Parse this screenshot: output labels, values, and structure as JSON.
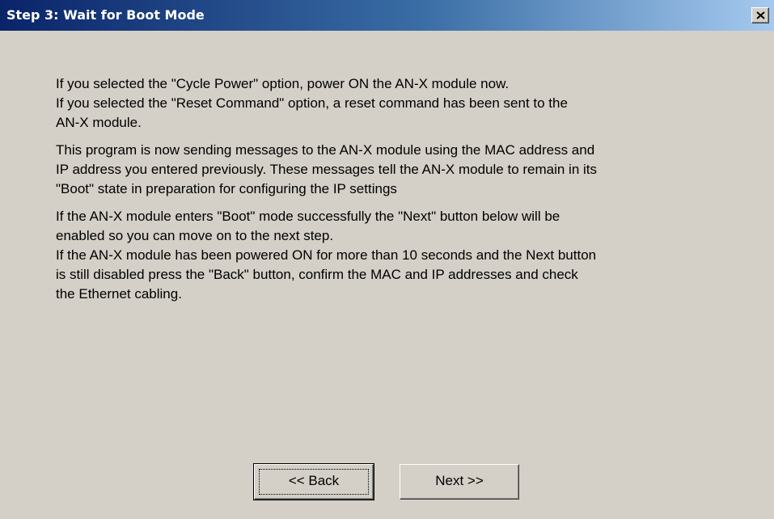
{
  "window": {
    "title": "Step 3: Wait for Boot Mode",
    "close_label": "×"
  },
  "content": {
    "paragraphs": [
      {
        "lines": [
          "If you selected the \"Cycle Power\" option, power ON the AN-X module now.",
          "If you selected the \"Reset Command\" option, a reset command has been sent to the",
          "AN-X module."
        ]
      },
      {
        "lines": [
          "This program is now sending messages to the AN-X module using the MAC address and",
          "IP address you entered previously. These messages tell the AN-X module to remain in its",
          "\"Boot\" state in preparation for configuring the IP settings"
        ]
      },
      {
        "lines": [
          "If the AN-X module enters \"Boot\" mode successfully the \"Next\" button below will be",
          "enabled so you can move on to the next step.",
          "If the AN-X module has been powered ON for more than 10 seconds and the Next button",
          "is still disabled press the \"Back\" button, confirm the MAC and IP addresses and check",
          "the Ethernet cabling."
        ]
      }
    ]
  },
  "buttons": {
    "back_label": "<< Back",
    "next_label": "Next >>"
  },
  "colors": {
    "titlebar_start": "#0a246a",
    "titlebar_end": "#a6caf0",
    "dialog_bg": "#d4d0c8"
  }
}
